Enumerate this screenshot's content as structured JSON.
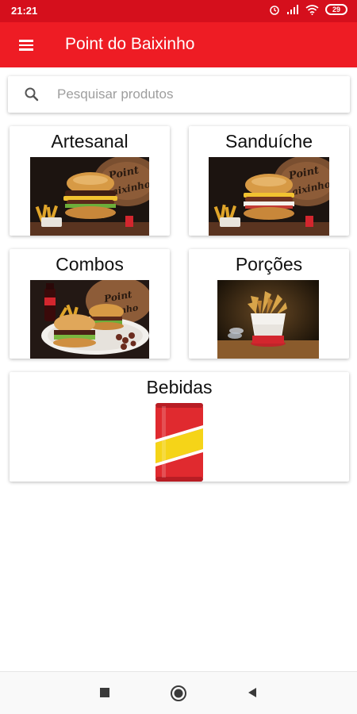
{
  "status_bar": {
    "time": "21:21",
    "battery": "29"
  },
  "app_bar": {
    "title": "Point do Baixinho"
  },
  "search": {
    "placeholder": "Pesquisar produtos",
    "value": ""
  },
  "categories": [
    {
      "label": "Artesanal"
    },
    {
      "label": "Sanduíche"
    },
    {
      "label": "Combos"
    },
    {
      "label": "Porções"
    },
    {
      "label": "Bebidas"
    }
  ],
  "colors": {
    "status_bar": "#d50f1c",
    "app_bar": "#ee1c24",
    "can_red": "#e02a2f",
    "can_yellow": "#f5d418"
  }
}
